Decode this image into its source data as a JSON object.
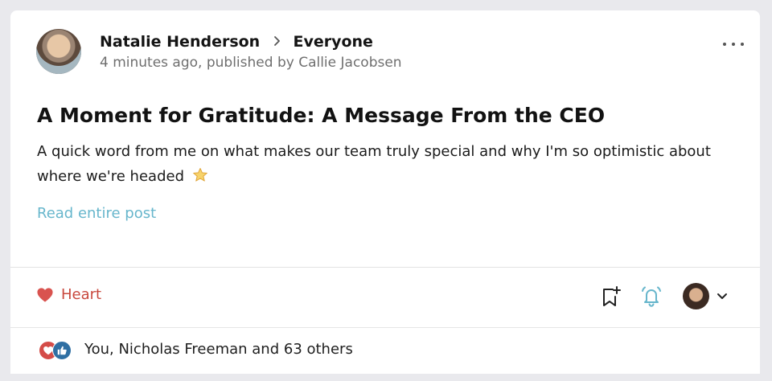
{
  "post": {
    "author": "Natalie Henderson",
    "audience": "Everyone",
    "meta": "4 minutes ago, published by Callie Jacobsen",
    "title": "A Moment for Gratitude: A Message From the CEO",
    "body": "A quick word from me on what makes our team truly special and why I'm so optimistic about where we're headed",
    "read_more": "Read entire post"
  },
  "actions": {
    "heart_label": "Heart",
    "icons": [
      "heart-icon",
      "bookmark-add-icon",
      "bell-icon",
      "viewer-avatar",
      "chevron-down-icon"
    ]
  },
  "reactions": {
    "summary": "You, Nicholas Freeman and 63 others"
  },
  "colors": {
    "accent_link": "#67b6cc",
    "heart_red": "#c8483d",
    "like_blue": "#2f6fa3",
    "background": "#e9e9ed"
  }
}
